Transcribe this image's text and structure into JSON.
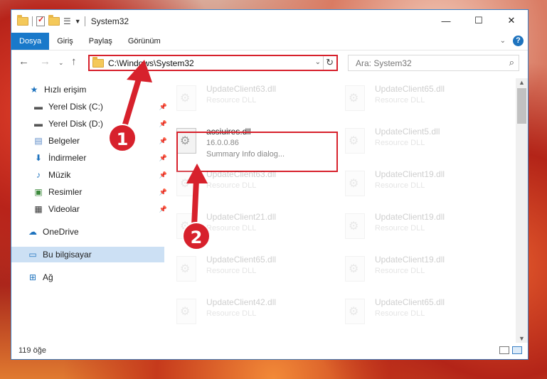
{
  "window": {
    "title": "System32",
    "controls": {
      "minimize": "—",
      "maximize": "☐",
      "close": "✕"
    }
  },
  "ribbon": {
    "tabs": [
      "Dosya",
      "Giriş",
      "Paylaş",
      "Görünüm"
    ],
    "active_tab": "Dosya",
    "help": "?"
  },
  "address_bar": {
    "path": "C:\\Windows\\System32"
  },
  "search": {
    "placeholder": "Ara: System32"
  },
  "nav": {
    "items": [
      {
        "label": "Hızlı erişim",
        "icon": "star-icon",
        "pinned": false,
        "indent": false
      },
      {
        "label": "Yerel Disk (C:)",
        "icon": "drive-icon",
        "pinned": true,
        "indent": true
      },
      {
        "label": "Yerel Disk (D:)",
        "icon": "drive-icon",
        "pinned": true,
        "indent": true
      },
      {
        "label": "Belgeler",
        "icon": "documents-icon",
        "pinned": true,
        "indent": true
      },
      {
        "label": "İndirmeler",
        "icon": "download-icon",
        "pinned": true,
        "indent": true
      },
      {
        "label": "Müzik",
        "icon": "music-icon",
        "pinned": true,
        "indent": true
      },
      {
        "label": "Resimler",
        "icon": "pictures-icon",
        "pinned": true,
        "indent": true
      },
      {
        "label": "Videolar",
        "icon": "video-icon",
        "pinned": true,
        "indent": true
      },
      {
        "label": "OneDrive",
        "icon": "cloud-icon",
        "pinned": false,
        "indent": false
      },
      {
        "label": "Bu bilgisayar",
        "icon": "computer-icon",
        "pinned": false,
        "indent": false,
        "selected": true
      },
      {
        "label": "Ağ",
        "icon": "network-icon",
        "pinned": false,
        "indent": false
      }
    ]
  },
  "files": {
    "highlighted": {
      "name": "acsiuires.dll",
      "version": "16.0.0.86",
      "description": "Summary Info dialog..."
    },
    "left_column": [
      {
        "name": "UpdateClient63.dll",
        "type": "Resource DLL"
      },
      {
        "name": "UpdateClient63.dll",
        "type": "Resource DLL"
      },
      {
        "name": "UpdateClient21.dll",
        "type": "Resource DLL"
      },
      {
        "name": "UpdateClient65.dll",
        "type": "Resource DLL"
      },
      {
        "name": "UpdateClient42.dll",
        "type": "Resource DLL"
      }
    ],
    "right_column": [
      {
        "name": "UpdateClient65.dll",
        "type": "Resource DLL"
      },
      {
        "name": "UpdateClient5.dll",
        "type": "Resource DLL"
      },
      {
        "name": "UpdateClient19.dll",
        "type": "Resource DLL"
      },
      {
        "name": "UpdateClient19.dll",
        "type": "Resource DLL"
      },
      {
        "name": "UpdateClient19.dll",
        "type": "Resource DLL"
      },
      {
        "name": "UpdateClient65.dll",
        "type": "Resource DLL"
      }
    ]
  },
  "status": {
    "item_count": "119 öğe"
  },
  "annotations": {
    "callout_1": "1",
    "callout_2": "2",
    "color": "#d7212c"
  }
}
